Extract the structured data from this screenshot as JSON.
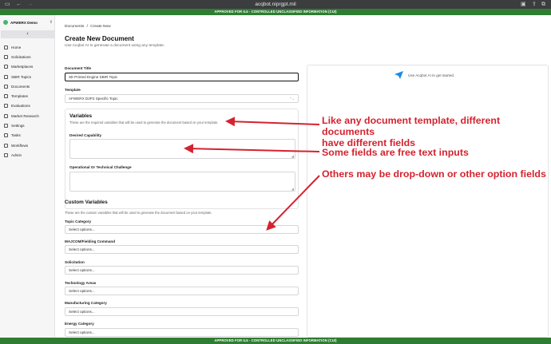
{
  "browser": {
    "url": "acqbot.niprgpt.mil"
  },
  "banner": {
    "top": "APPROVED FOR IL5 - CONTROLLED UNCLASSIFIED INFORMATION (CUI)",
    "bottom": "APPROVED FOR IL5 - CONTROLLED UNCLASSIFIED INFORMATION (CUI)"
  },
  "sidebar": {
    "org_name": "AFWERX Demo",
    "items": [
      {
        "label": "Home",
        "icon": "home-icon"
      },
      {
        "label": "Solicitations",
        "icon": "document-icon"
      },
      {
        "label": "Marketplaces",
        "icon": "store-icon"
      },
      {
        "label": "SBIR Topics",
        "icon": "topics-icon"
      },
      {
        "label": "Documents",
        "icon": "file-icon"
      },
      {
        "label": "Templates",
        "icon": "template-icon"
      },
      {
        "label": "Evaluations",
        "icon": "evaluation-icon"
      },
      {
        "label": "Market Research",
        "icon": "research-icon"
      },
      {
        "label": "Settings",
        "icon": "gear-icon"
      },
      {
        "label": "Tasks",
        "icon": "tasks-icon"
      },
      {
        "label": "Workflows",
        "icon": "workflow-icon"
      },
      {
        "label": "Admin",
        "icon": "admin-icon"
      }
    ]
  },
  "breadcrumb": {
    "parent": "Documents",
    "separator": "/",
    "current": "Create New"
  },
  "page": {
    "title": "Create New Document",
    "subtitle": "Use Acqbot AI to generate a document using any template."
  },
  "form": {
    "doc_title_label": "Document Title",
    "doc_title_value": "3D Printed Engine SBIR Topic",
    "template_label": "Template",
    "template_value": "AFWERX D2P2 Specific Topic",
    "variables_title": "Variables",
    "variables_desc": "These are the required variables that will be used to generate the document based on your template.",
    "desired_capability_label": "Desired Capability",
    "challenge_label": "Operational Or Technical Challenge",
    "custom_vars_title": "Custom Variables",
    "custom_vars_desc": "These are the custom variables that will be used to generate the document based on your template.",
    "select_placeholder": "Select options...",
    "custom_fields": [
      {
        "label": "Topic Category"
      },
      {
        "label": "MAJCOM/Fielding Command"
      },
      {
        "label": "Solicitation"
      },
      {
        "label": "Technology Areas"
      },
      {
        "label": "Manufacturing Category"
      },
      {
        "label": "Energy Category"
      }
    ]
  },
  "assistant": {
    "hint": "Use Acqbot AI to get started."
  },
  "annotations": {
    "a1_line1": "Like any document template, different documents",
    "a1_line2": "have different fields",
    "a2": "Some fields are free text inputs",
    "a3": "Others may be drop-down or other option fields",
    "color": "#d4232f"
  },
  "colors": {
    "banner": "#2f7d32",
    "accent": "#1e88e5",
    "org_logo": "#49b46e"
  }
}
